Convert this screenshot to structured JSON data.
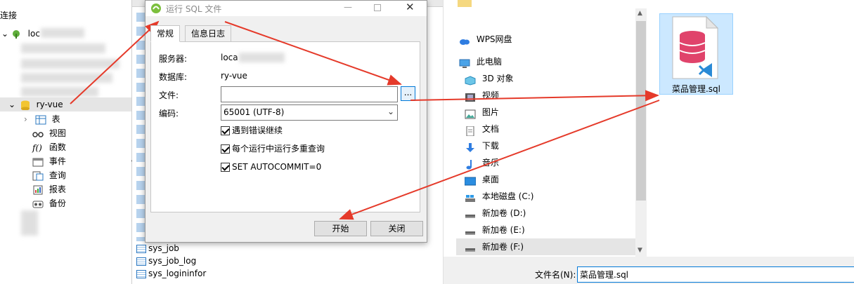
{
  "left_panel": {
    "header_label": "连接",
    "connection_prefix": "loc",
    "database_name": "ry-vue",
    "tree_items": [
      {
        "label": "表",
        "icon": "table-icon"
      },
      {
        "label": "视图",
        "icon": "view-icon"
      },
      {
        "label": "函数",
        "icon": "function-icon"
      },
      {
        "label": "事件",
        "icon": "event-icon"
      },
      {
        "label": "查询",
        "icon": "query-icon"
      },
      {
        "label": "报表",
        "icon": "report-icon"
      },
      {
        "label": "备份",
        "icon": "backup-icon"
      }
    ]
  },
  "table_list": {
    "visible_tables": [
      "sys_job",
      "sys_job_log",
      "sys_logininfor"
    ]
  },
  "dialog": {
    "title": "运行 SQL 文件",
    "tabs": [
      "常规",
      "信息日志"
    ],
    "server_label": "服务器:",
    "server_value": "loca",
    "database_label": "数据库:",
    "database_value": "ry-vue",
    "file_label": "文件:",
    "file_value": "",
    "browse_label": "...",
    "encoding_label": "编码:",
    "encoding_value": "65001 (UTF-8)",
    "options": [
      {
        "label": "遇到错误继续",
        "checked": true
      },
      {
        "label": "每个运行中运行多重查询",
        "checked": true
      },
      {
        "label": "SET AUTOCOMMIT=0",
        "checked": true
      }
    ],
    "start_label": "开始",
    "close_label": "关闭"
  },
  "explorer": {
    "nav_items": [
      {
        "label": "WPS网盘",
        "icon": "cloud-icon"
      },
      {
        "label": "此电脑",
        "icon": "computer-icon"
      },
      {
        "label": "3D 对象",
        "icon": "cube-icon"
      },
      {
        "label": "视频",
        "icon": "video-icon"
      },
      {
        "label": "图片",
        "icon": "picture-icon"
      },
      {
        "label": "文档",
        "icon": "document-icon"
      },
      {
        "label": "下载",
        "icon": "download-icon"
      },
      {
        "label": "音乐",
        "icon": "music-icon"
      },
      {
        "label": "桌面",
        "icon": "desktop-icon"
      },
      {
        "label": "本地磁盘 (C:)",
        "icon": "drive-icon"
      },
      {
        "label": "新加卷 (D:)",
        "icon": "drive-icon"
      },
      {
        "label": "新加卷 (E:)",
        "icon": "drive-icon"
      },
      {
        "label": "新加卷 (F:)",
        "icon": "drive-icon"
      }
    ],
    "file_name": "菜品管理.sql",
    "filename_label": "文件名(N):",
    "filename_value": "菜品管理.sql"
  },
  "colors": {
    "annotation_arrow": "#e53a2a",
    "selection": "#cce8ff",
    "db_icon": "#e0436b"
  }
}
